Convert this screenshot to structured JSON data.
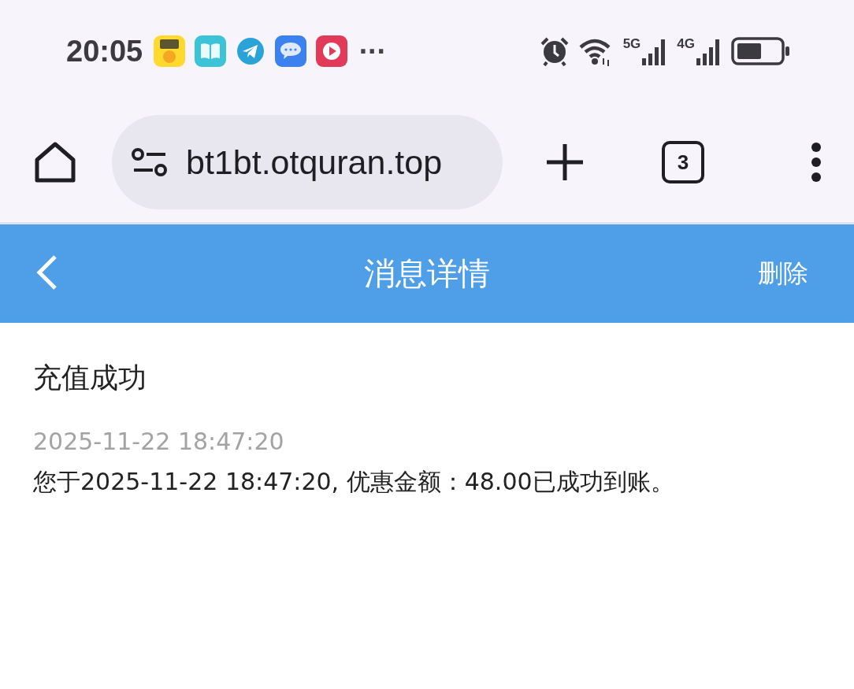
{
  "status_bar": {
    "time": "20:05",
    "more": "···",
    "network_5g": "5G",
    "network_4g": "4G"
  },
  "browser": {
    "url": "bt1bt.otquran.top",
    "tab_count": "3"
  },
  "header": {
    "title": "消息详情",
    "action": "删除"
  },
  "message": {
    "title": "充值成功",
    "time": "2025-11-22 18:47:20",
    "body": "您于2025-11-22 18:47:20, 优惠金额：48.00已成功到账。"
  }
}
